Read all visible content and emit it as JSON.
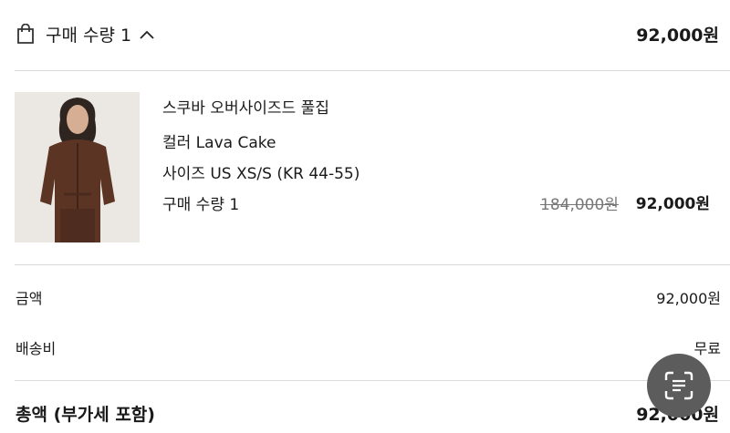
{
  "header": {
    "icon": "shopping-bag-icon",
    "quantity_label": "구매 수량 1",
    "toggle_icon": "chevron-up-icon",
    "total": "92,000원"
  },
  "product": {
    "image_description": "woman in brown oversized zip-up",
    "name": "스쿠바 오버사이즈드 풀집",
    "color": "컬러 Lava Cake",
    "size": "사이즈 US XS/S (KR 44-55)",
    "quantity": "구매 수량 1",
    "original_price": "184,000원",
    "sale_price": "92,000원"
  },
  "summary": {
    "amount_label": "금액",
    "amount_value": "92,000원",
    "shipping_label": "배송비",
    "shipping_value": "무료",
    "total_label": "총액 (부가세 포함)",
    "total_value": "92,000원"
  },
  "floating_action": {
    "icon": "text-scan-icon"
  }
}
